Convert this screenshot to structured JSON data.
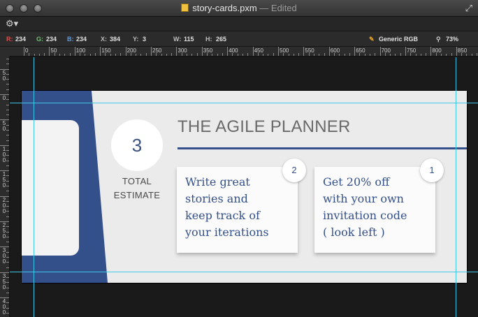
{
  "window": {
    "filename": "story-cards.pxm",
    "status": "Edited"
  },
  "info": {
    "r_label": "R:",
    "r": "234",
    "g_label": "G:",
    "g": "234",
    "b_label": "B:",
    "b": "234",
    "x_label": "X:",
    "x": "384",
    "y_label": "Y:",
    "y": "3",
    "w_label": "W:",
    "w": "115",
    "h_label": "H:",
    "h": "265",
    "color_profile": "Generic RGB",
    "zoom": "73%"
  },
  "ruler": {
    "h_labels": [
      "0",
      "50",
      "100",
      "150",
      "200",
      "250",
      "300",
      "350",
      "400",
      "450",
      "500",
      "550",
      "600",
      "650",
      "700",
      "750",
      "800",
      "850"
    ],
    "v_labels": [
      "5 0",
      "0",
      "5 0",
      "1 0 0",
      "1 5 0",
      "2 0 0",
      "2 5 0",
      "3 0 0",
      "3 5 0",
      "4 0 0"
    ]
  },
  "design": {
    "estimate_number": "3",
    "estimate_label_1": "TOTAL",
    "estimate_label_2": "ESTIMATE",
    "heading": "THE AGILE PLANNER",
    "cards": [
      {
        "text": "Write great\nstories and\nkeep track of\nyour iterations",
        "badge": "2"
      },
      {
        "text": "Get 20% off\nwith your own\ninvitation code\n( look left )",
        "badge": "1"
      }
    ]
  },
  "colors": {
    "accent_blue": "#34508a",
    "artboard_bg": "#ebebeb",
    "guide": "#3fc8e8"
  },
  "icons": {
    "gear": "gear-icon",
    "fullscreen": "fullscreen-icon",
    "document": "document-icon",
    "color_profile": "eyedropper-icon",
    "zoom": "magnifier-icon"
  }
}
